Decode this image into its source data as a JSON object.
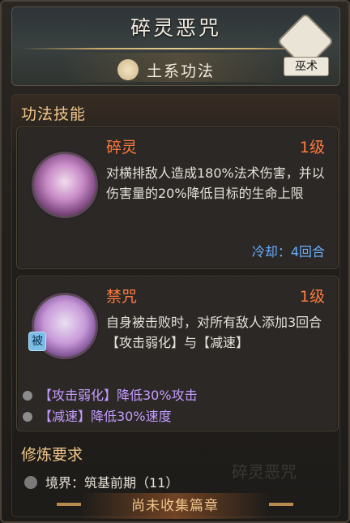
{
  "header": {
    "title": "碎灵恶咒",
    "subtitle": "土系功法",
    "badge": "巫术",
    "badge_icon": "swirl-emblem-icon",
    "subtitle_icon": "mountain-earth-icon"
  },
  "skills_section": {
    "title": "功法技能",
    "skills": [
      {
        "name": "碎灵",
        "level": "1级",
        "description": "对横排敌人造成180%法术伤害，并以伤害量的20%降低目标的生命上限",
        "cooldown": "冷却：4回合",
        "icon": "purple-crystal-orb-icon"
      },
      {
        "name": "禁咒",
        "level": "1级",
        "description": "自身被击败时，对所有敌人添加3回合【攻击弱化】与【减速】",
        "tag": "被",
        "icon": "purple-chains-orb-icon",
        "effects": [
          "【攻击弱化】降低30%攻击",
          "【减速】降低30%速度"
        ]
      }
    ]
  },
  "requirements": {
    "title": "修炼要求",
    "items": [
      "境界：筑基前期（11）"
    ],
    "watermark": "碎灵恶咒"
  },
  "footer": {
    "banner": "尚未收集篇章"
  },
  "colors": {
    "accent_orange": "#ff7a3d",
    "cooldown_blue": "#69b0ff",
    "effect_purple": "#c59cff",
    "section_gold": "#f0c68a"
  }
}
